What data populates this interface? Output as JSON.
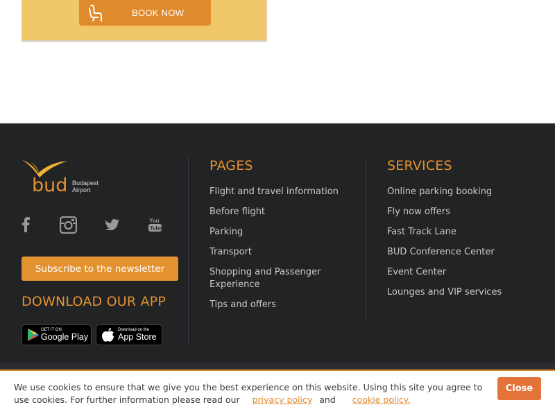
{
  "promo": {
    "book_now_label": "BOOK NOW",
    "icon": "seat-icon"
  },
  "footer": {
    "logo": {
      "wordmark": "bud",
      "line1": "Budapest",
      "line2": "Airport"
    },
    "social_icons": [
      "facebook-icon",
      "instagram-icon",
      "twitter-icon",
      "youtube-icon"
    ],
    "subscribe_label": "Subscribe to the newsletter",
    "download_title": "DOWNLOAD OUR APP",
    "google_play": {
      "small": "GET IT ON",
      "big": "Google Play"
    },
    "app_store": {
      "small": "Download on the",
      "big": "App Store"
    },
    "pages": {
      "title": "PAGES",
      "items": [
        "Flight and travel information",
        "Before flight",
        "Parking",
        "Transport",
        "Shopping and Passenger Experience",
        "Tips and offers"
      ]
    },
    "services": {
      "title": "SERVICES",
      "items": [
        "Online parking booking",
        "Fly now offers",
        "Fast Track Lane",
        "BUD Conference Center",
        "Event Center",
        "Lounges and VIP services"
      ]
    }
  },
  "cookie": {
    "text": "We use cookies to ensure that we give you the best experience on this website. Using this site you agree to use cookies. For further information please read our",
    "privacy_link": "privacy policy",
    "and": "and",
    "cookie_link": "cookie policy.",
    "close_label": "Close"
  },
  "colors": {
    "accent": "#e4912f",
    "footer_bg": "#222325",
    "promo_bg": "#f0c86a",
    "close_bg": "#e4733a"
  }
}
